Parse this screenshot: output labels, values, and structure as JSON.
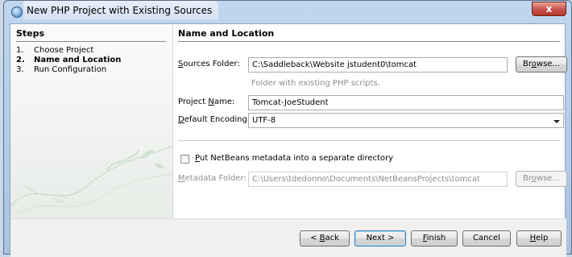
{
  "window": {
    "title": "New PHP Project with Existing Sources",
    "close_label": "x"
  },
  "steps": {
    "title": "Steps",
    "items": [
      {
        "num": "1.",
        "label": "Choose Project",
        "active": false
      },
      {
        "num": "2.",
        "label": "Name and Location",
        "active": true
      },
      {
        "num": "3.",
        "label": "Run Configuration",
        "active": false
      }
    ]
  },
  "form": {
    "section_title": "Name and Location",
    "sources_folder": {
      "label_mnemonic": "S",
      "label_rest": "ources Folder:",
      "value": "C:\\Saddleback\\Website jstudent0\\tomcat",
      "hint": "Folder with existing PHP scripts."
    },
    "browse_button": {
      "pre": "Br",
      "mnemonic": "o",
      "post": "wse..."
    },
    "project_name": {
      "label_pre": "Project ",
      "label_mnemonic": "N",
      "label_post": "ame:",
      "value": "Tomcat-JoeStudent"
    },
    "default_encoding": {
      "label_mnemonic": "D",
      "label_rest": "efault Encoding:",
      "value": "UTF-8"
    },
    "netbeans_metadata": {
      "checked": false,
      "label_mnemonic": "P",
      "label_rest": "ut NetBeans metadata into a separate directory"
    },
    "metadata_folder": {
      "label_mnemonic": "M",
      "label_rest": "etadata Folder:",
      "value": "C:\\Users\\tdedonno\\Documents\\NetBeansProjects\\tomcat"
    },
    "browse2_button": {
      "pre": "Br",
      "mnemonic": "o",
      "post": "wse..."
    }
  },
  "footer": {
    "back": {
      "pre": "< ",
      "mnemonic": "B",
      "post": "ack"
    },
    "next": "Next >",
    "finish": {
      "mnemonic": "F",
      "post": "inish"
    },
    "cancel": "Cancel",
    "help": {
      "mnemonic": "H",
      "post": "elp"
    }
  },
  "colors": {
    "title_bar": "#b9d1ea",
    "close_button": "#c75050",
    "disabled_text": "#8d8d8d"
  }
}
